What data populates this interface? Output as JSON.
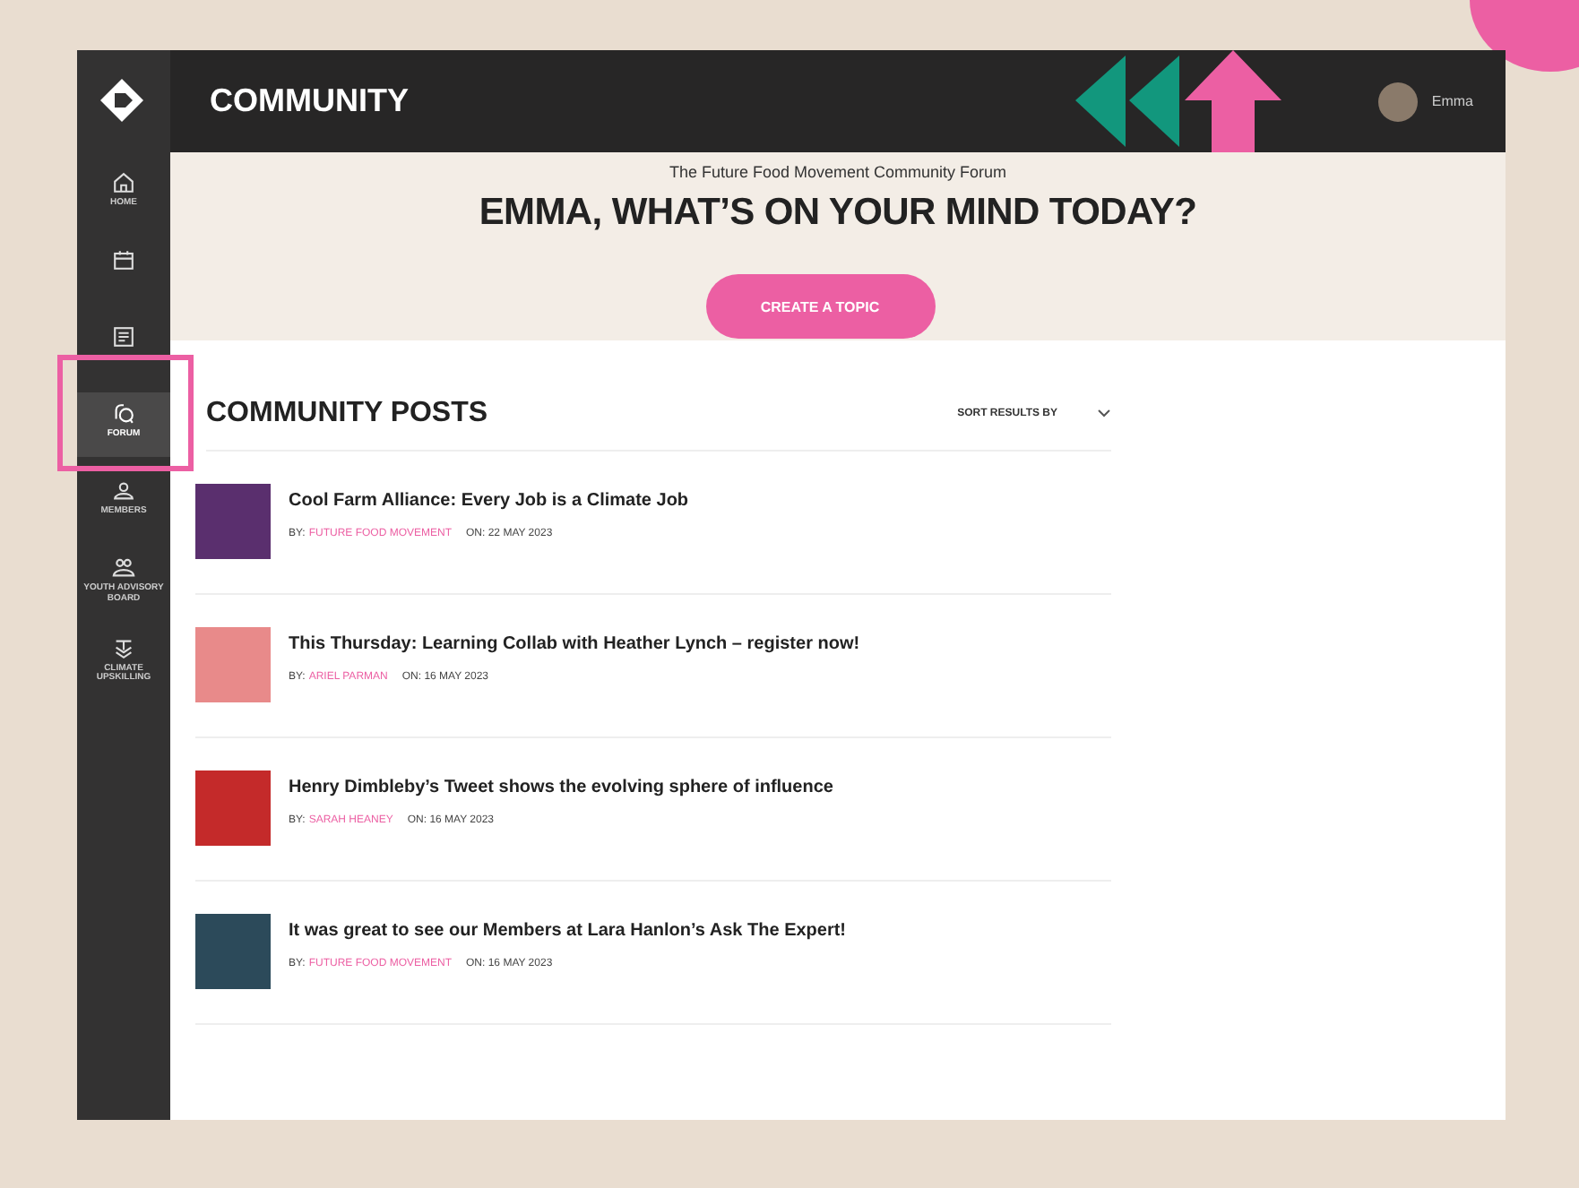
{
  "header": {
    "title": "COMMUNITY",
    "user": {
      "name": "Emma"
    }
  },
  "sidebar": {
    "items": [
      {
        "kind": "home",
        "label": "HOME",
        "selected": false
      },
      {
        "kind": "calendar",
        "selected": false
      },
      {
        "kind": "document",
        "selected": false
      },
      {
        "kind": "forum",
        "label": "FORUM",
        "selected": true
      },
      {
        "kind": "people",
        "label": "MEMBERS",
        "selected": false
      },
      {
        "kind": "person-group",
        "label": "YOUTH ADVISORY BOARD",
        "selected": false
      },
      {
        "kind": "layers",
        "label": "CLIMATE UPSKILLING",
        "selected": false
      }
    ]
  },
  "hero": {
    "subtitle": "The Future Food Movement Community Forum",
    "heading": "EMMA, WHAT’S ON YOUR MIND TODAY?",
    "button": "CREATE A TOPIC"
  },
  "posts": {
    "title": "COMMUNITY POSTS",
    "sort": "SORT RESULTS BY",
    "items": [
      {
        "title": "Cool Farm Alliance: Every Job is a Climate Job",
        "by": "BY:",
        "author": "FUTURE FOOD MOVEMENT",
        "date": "ON: 22 MAY 2023",
        "color": "#5a2f6e"
      },
      {
        "title": "This Thursday: Learning Collab with Heather Lynch – register now!",
        "by": "BY:",
        "author": "ARIEL PARMAN",
        "date": "ON: 16 MAY 2023",
        "color": "#e88a8a"
      },
      {
        "title": "Henry Dimbleby’s Tweet shows the evolving sphere of influence",
        "by": "BY:",
        "author": "SARAH HEANEY",
        "date": "ON: 16 MAY 2023",
        "color": "#c42a2a"
      },
      {
        "title": "It was great to see our Members at Lara Hanlon’s Ask The Expert!",
        "by": "BY:",
        "author": "FUTURE FOOD MOVEMENT",
        "date": "ON: 16 MAY 2023",
        "color": "#2c4a5a"
      }
    ]
  }
}
